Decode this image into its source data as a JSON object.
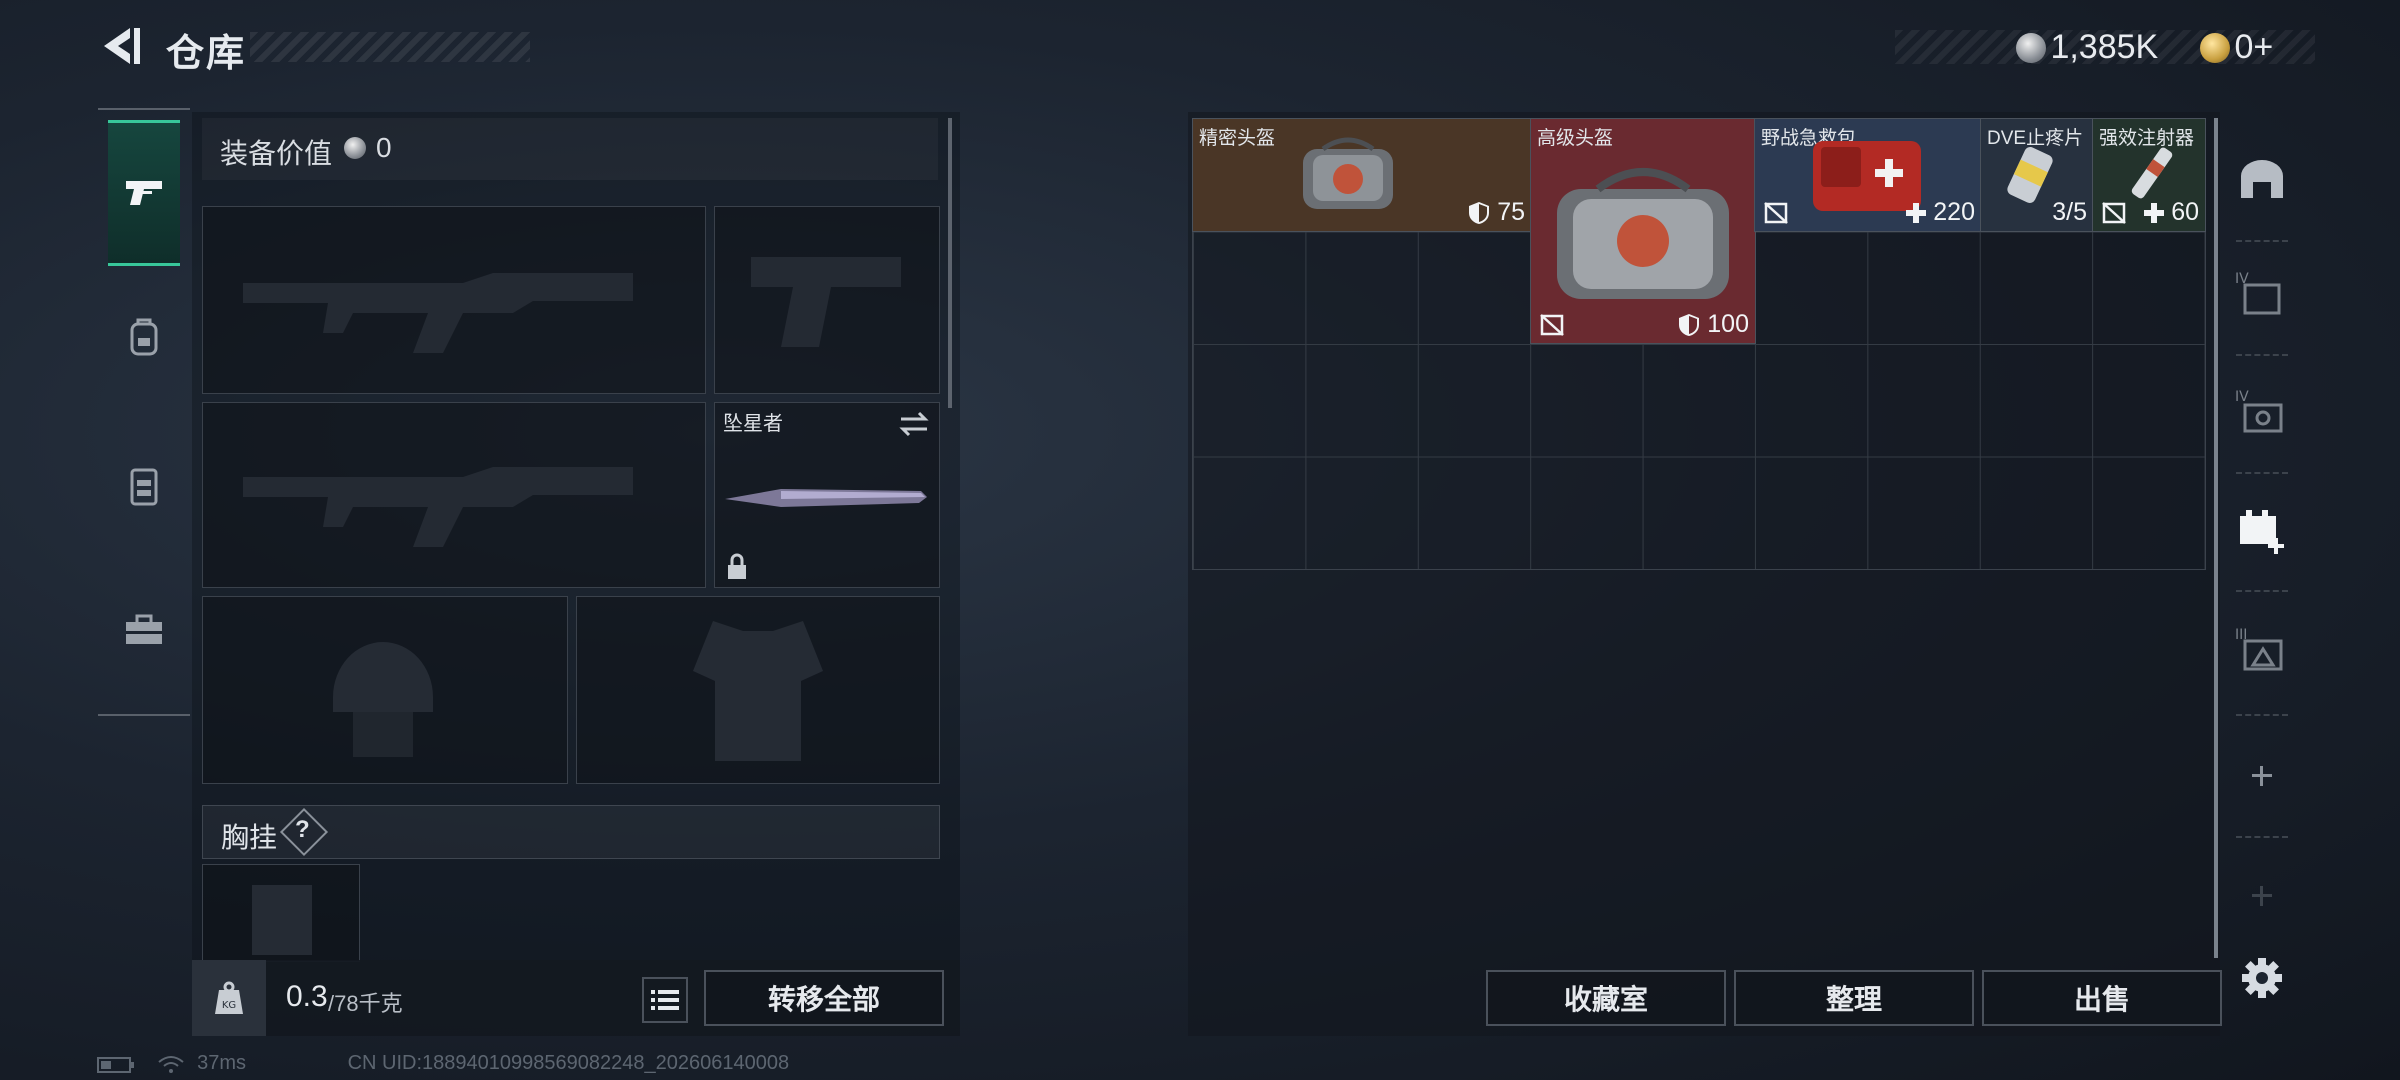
{
  "header": {
    "title": "仓库"
  },
  "currency": {
    "silver": "1,385K",
    "gold": "0+"
  },
  "tabs": [
    {
      "icon": "pistol-icon",
      "active": true
    },
    {
      "icon": "backpack-icon",
      "active": false
    },
    {
      "icon": "vest-icon",
      "active": false
    },
    {
      "icon": "toolbox-icon",
      "active": false
    }
  ],
  "loadout": {
    "equip_value_label": "装备价值",
    "equip_value": "0",
    "melee_name": "坠星者",
    "chest_label": "胸挂",
    "chest_help": "?",
    "weight_current": "0.3",
    "weight_max": "/78千克",
    "weight_unit_icon": "KG",
    "transfer_all": "转移全部"
  },
  "inventory": {
    "items": [
      {
        "name": "精密头盔",
        "stat": "75",
        "stat_icon": "shield-icon",
        "bg": "#4a3626"
      },
      {
        "name": "高级头盔",
        "stat": "100",
        "stat_icon": "shield-icon",
        "bg": "#6a2a30"
      },
      {
        "name": "野战急救包",
        "stat": "220",
        "stat_icon": "plus-icon",
        "bg": "#2c3a52"
      },
      {
        "name": "DVE止疼片",
        "stat": "3/5",
        "stat_icon": "",
        "bg": "#27313f"
      },
      {
        "name": "强效注射器",
        "stat": "60",
        "stat_icon": "plus-icon",
        "bg": "#23332c"
      }
    ],
    "buttons": {
      "collection": "收藏室",
      "sort": "整理",
      "sell": "出售"
    }
  },
  "status": {
    "ping": "37ms",
    "uid": "CN UID:18894010998569082248_202606140008"
  }
}
